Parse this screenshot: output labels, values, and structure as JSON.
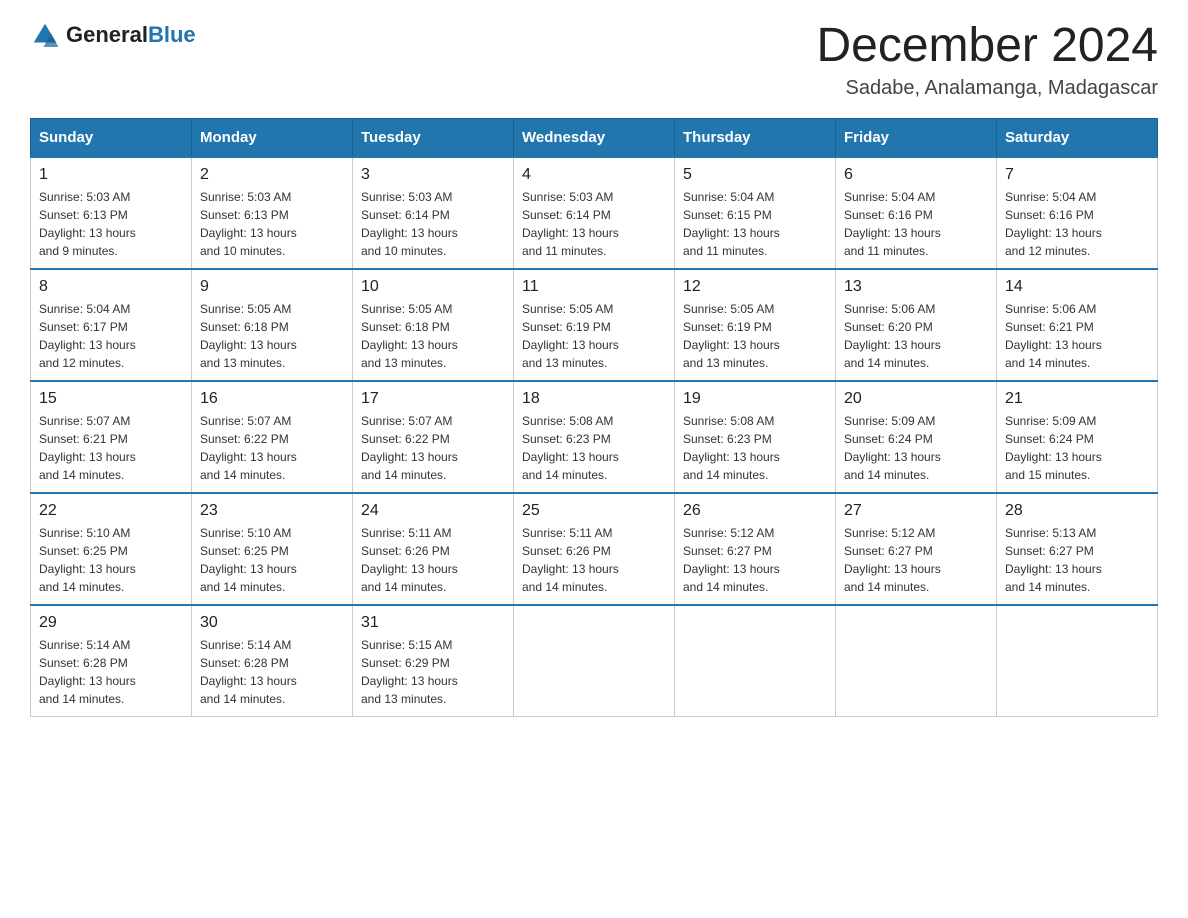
{
  "logo": {
    "text_general": "General",
    "text_blue": "Blue"
  },
  "title": "December 2024",
  "subtitle": "Sadabe, Analamanga, Madagascar",
  "days_header": [
    "Sunday",
    "Monday",
    "Tuesday",
    "Wednesday",
    "Thursday",
    "Friday",
    "Saturday"
  ],
  "weeks": [
    [
      {
        "day": "1",
        "sunrise": "5:03 AM",
        "sunset": "6:13 PM",
        "daylight": "13 hours and 9 minutes."
      },
      {
        "day": "2",
        "sunrise": "5:03 AM",
        "sunset": "6:13 PM",
        "daylight": "13 hours and 10 minutes."
      },
      {
        "day": "3",
        "sunrise": "5:03 AM",
        "sunset": "6:14 PM",
        "daylight": "13 hours and 10 minutes."
      },
      {
        "day": "4",
        "sunrise": "5:03 AM",
        "sunset": "6:14 PM",
        "daylight": "13 hours and 11 minutes."
      },
      {
        "day": "5",
        "sunrise": "5:04 AM",
        "sunset": "6:15 PM",
        "daylight": "13 hours and 11 minutes."
      },
      {
        "day": "6",
        "sunrise": "5:04 AM",
        "sunset": "6:16 PM",
        "daylight": "13 hours and 11 minutes."
      },
      {
        "day": "7",
        "sunrise": "5:04 AM",
        "sunset": "6:16 PM",
        "daylight": "13 hours and 12 minutes."
      }
    ],
    [
      {
        "day": "8",
        "sunrise": "5:04 AM",
        "sunset": "6:17 PM",
        "daylight": "13 hours and 12 minutes."
      },
      {
        "day": "9",
        "sunrise": "5:05 AM",
        "sunset": "6:18 PM",
        "daylight": "13 hours and 13 minutes."
      },
      {
        "day": "10",
        "sunrise": "5:05 AM",
        "sunset": "6:18 PM",
        "daylight": "13 hours and 13 minutes."
      },
      {
        "day": "11",
        "sunrise": "5:05 AM",
        "sunset": "6:19 PM",
        "daylight": "13 hours and 13 minutes."
      },
      {
        "day": "12",
        "sunrise": "5:05 AM",
        "sunset": "6:19 PM",
        "daylight": "13 hours and 13 minutes."
      },
      {
        "day": "13",
        "sunrise": "5:06 AM",
        "sunset": "6:20 PM",
        "daylight": "13 hours and 14 minutes."
      },
      {
        "day": "14",
        "sunrise": "5:06 AM",
        "sunset": "6:21 PM",
        "daylight": "13 hours and 14 minutes."
      }
    ],
    [
      {
        "day": "15",
        "sunrise": "5:07 AM",
        "sunset": "6:21 PM",
        "daylight": "13 hours and 14 minutes."
      },
      {
        "day": "16",
        "sunrise": "5:07 AM",
        "sunset": "6:22 PM",
        "daylight": "13 hours and 14 minutes."
      },
      {
        "day": "17",
        "sunrise": "5:07 AM",
        "sunset": "6:22 PM",
        "daylight": "13 hours and 14 minutes."
      },
      {
        "day": "18",
        "sunrise": "5:08 AM",
        "sunset": "6:23 PM",
        "daylight": "13 hours and 14 minutes."
      },
      {
        "day": "19",
        "sunrise": "5:08 AM",
        "sunset": "6:23 PM",
        "daylight": "13 hours and 14 minutes."
      },
      {
        "day": "20",
        "sunrise": "5:09 AM",
        "sunset": "6:24 PM",
        "daylight": "13 hours and 14 minutes."
      },
      {
        "day": "21",
        "sunrise": "5:09 AM",
        "sunset": "6:24 PM",
        "daylight": "13 hours and 15 minutes."
      }
    ],
    [
      {
        "day": "22",
        "sunrise": "5:10 AM",
        "sunset": "6:25 PM",
        "daylight": "13 hours and 14 minutes."
      },
      {
        "day": "23",
        "sunrise": "5:10 AM",
        "sunset": "6:25 PM",
        "daylight": "13 hours and 14 minutes."
      },
      {
        "day": "24",
        "sunrise": "5:11 AM",
        "sunset": "6:26 PM",
        "daylight": "13 hours and 14 minutes."
      },
      {
        "day": "25",
        "sunrise": "5:11 AM",
        "sunset": "6:26 PM",
        "daylight": "13 hours and 14 minutes."
      },
      {
        "day": "26",
        "sunrise": "5:12 AM",
        "sunset": "6:27 PM",
        "daylight": "13 hours and 14 minutes."
      },
      {
        "day": "27",
        "sunrise": "5:12 AM",
        "sunset": "6:27 PM",
        "daylight": "13 hours and 14 minutes."
      },
      {
        "day": "28",
        "sunrise": "5:13 AM",
        "sunset": "6:27 PM",
        "daylight": "13 hours and 14 minutes."
      }
    ],
    [
      {
        "day": "29",
        "sunrise": "5:14 AM",
        "sunset": "6:28 PM",
        "daylight": "13 hours and 14 minutes."
      },
      {
        "day": "30",
        "sunrise": "5:14 AM",
        "sunset": "6:28 PM",
        "daylight": "13 hours and 14 minutes."
      },
      {
        "day": "31",
        "sunrise": "5:15 AM",
        "sunset": "6:29 PM",
        "daylight": "13 hours and 13 minutes."
      },
      null,
      null,
      null,
      null
    ]
  ],
  "labels": {
    "sunrise": "Sunrise:",
    "sunset": "Sunset:",
    "daylight": "Daylight:"
  }
}
